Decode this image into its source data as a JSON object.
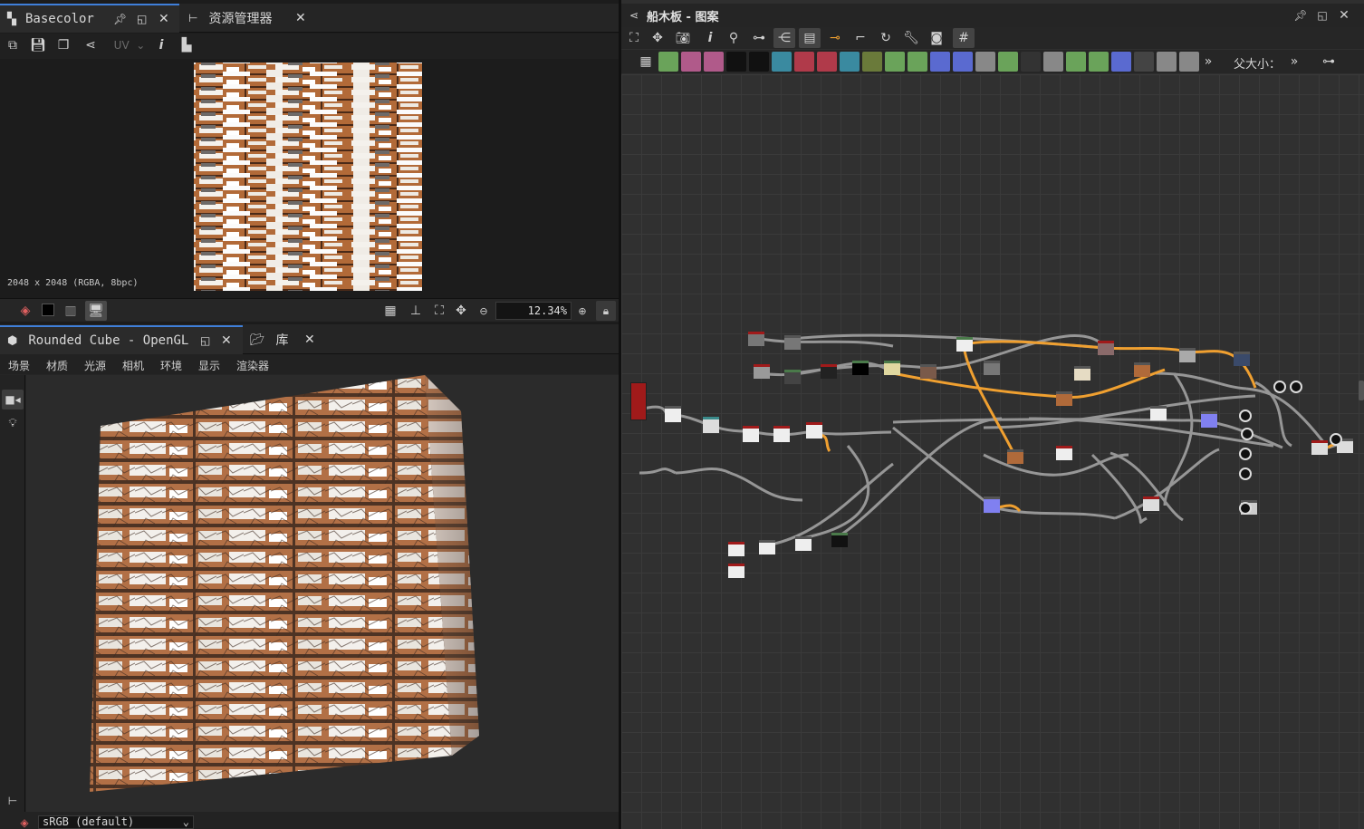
{
  "panels": {
    "texture_view": {
      "tab_title": "Basecolor",
      "tab2_title": "资源管理器",
      "uv_label": "UV",
      "info_text": "2048 x 2048 (RGBA, 8bpc)",
      "zoom_value": "12.34%"
    },
    "view3d": {
      "tab_title": "Rounded Cube - OpenGL",
      "tab2_title": "库",
      "menu": [
        "场景",
        "材质",
        "光源",
        "相机",
        "环境",
        "显示",
        "渲染器"
      ],
      "colorspace_value": "sRGB (default)"
    },
    "graph": {
      "title": "船木板 - 图案",
      "parent_size_label": "父大小：",
      "more_glyph": "»"
    }
  },
  "colors": {
    "accent": "#3f7fd9",
    "node_orange_link": "#f0a030",
    "node_gray_link": "#a8a8a8",
    "wood": "#b0683a"
  },
  "icons": {
    "texture_toolbar": [
      "copy-icon",
      "save-icon",
      "export-icon",
      "share-icon",
      "info-icon",
      "histogram-icon"
    ],
    "graph_toolbar": [
      "frame-icon",
      "pan-icon",
      "camera-icon",
      "info-icon",
      "zoom-icon",
      "link-icon",
      "layout-icon",
      "panel-icon",
      "connect-icon",
      "route-icon",
      "refresh-icon",
      "wrench-icon",
      "snapshot-icon",
      "grid-icon"
    ]
  }
}
